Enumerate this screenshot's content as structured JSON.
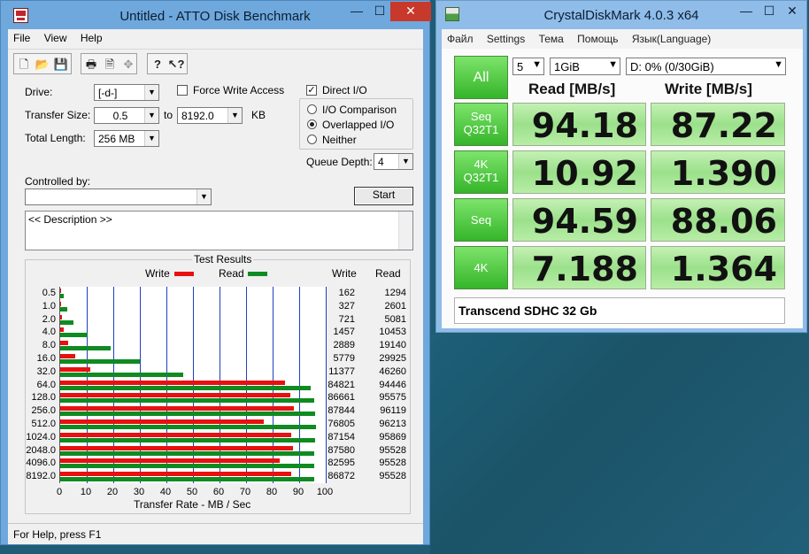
{
  "atto": {
    "title": "Untitled - ATTO Disk Benchmark",
    "window_buttons": {
      "minimize": "—",
      "maximize": "☐",
      "close": "✕"
    },
    "menu": [
      "File",
      "View",
      "Help"
    ],
    "toolbar_icons": [
      "new-icon",
      "open-icon",
      "save-icon",
      "print-icon",
      "print-preview-icon",
      "move-icon",
      "help-icon",
      "context-help-icon"
    ],
    "drive_label": "Drive:",
    "drive_value": "[-d-]",
    "force_write_access_label": "Force Write Access",
    "direct_io_label": "Direct I/O",
    "transfer_size_label": "Transfer Size:",
    "transfer_size_from": "0.5",
    "to_label": "to",
    "transfer_size_to": "8192.0",
    "kb_label": "KB",
    "total_length_label": "Total Length:",
    "total_length_value": "256 MB",
    "io_comparison_label": "I/O Comparison",
    "overlapped_io_label": "Overlapped I/O",
    "neither_label": "Neither",
    "queue_depth_label": "Queue Depth:",
    "queue_depth_value": "4",
    "controlled_by_label": "Controlled by:",
    "controlled_by_value": "",
    "start_label": "Start",
    "description": "<< Description >>",
    "status": "For Help, press F1",
    "results": {
      "title": "Test Results",
      "legend_write": "Write",
      "legend_read": "Read",
      "col_write": "Write",
      "col_read": "Read",
      "xlabel": "Transfer Rate - MB / Sec",
      "xticks": [
        "0",
        "10",
        "20",
        "30",
        "40",
        "50",
        "60",
        "70",
        "80",
        "90",
        "100"
      ],
      "write_color": "#e81010",
      "read_color": "#0f8b21"
    }
  },
  "chart_data": {
    "type": "bar",
    "orientation": "horizontal",
    "title": "Test Results",
    "xlabel": "Transfer Rate - MB / Sec",
    "xlim": [
      0,
      100
    ],
    "categories": [
      "0.5",
      "1.0",
      "2.0",
      "4.0",
      "8.0",
      "16.0",
      "32.0",
      "64.0",
      "128.0",
      "256.0",
      "512.0",
      "1024.0",
      "2048.0",
      "4096.0",
      "8192.0"
    ],
    "series": [
      {
        "name": "Write",
        "values": [
          162,
          327,
          721,
          1457,
          2889,
          5779,
          11377,
          84821,
          86661,
          87844,
          76805,
          87154,
          87580,
          82595,
          86872
        ]
      },
      {
        "name": "Read",
        "values": [
          1294,
          2601,
          5081,
          10453,
          19140,
          29925,
          46260,
          94446,
          95575,
          96119,
          96213,
          95869,
          95528,
          95528,
          95528
        ]
      }
    ],
    "value_units": "KB/s",
    "grid": true,
    "legend": "top"
  },
  "cdm": {
    "title": "CrystalDiskMark 4.0.3 x64",
    "window_buttons": {
      "minimize": "—",
      "maximize": "☐",
      "close": "✕"
    },
    "menu": [
      "Файл",
      "Settings",
      "Тема",
      "Помощь",
      "Язык(Language)"
    ],
    "all_label": "All",
    "count_value": "5",
    "size_value": "1GiB",
    "drive_value": "D: 0% (0/30GiB)",
    "read_header": "Read [MB/s]",
    "write_header": "Write [MB/s]",
    "rows": [
      {
        "line1": "Seq",
        "line2": "Q32T1",
        "read": "94.18",
        "write": "87.22"
      },
      {
        "line1": "4K",
        "line2": "Q32T1",
        "read": "10.92",
        "write": "1.390"
      },
      {
        "line1": "Seq",
        "line2": "",
        "read": "94.59",
        "write": "88.06"
      },
      {
        "line1": "4K",
        "line2": "",
        "read": "7.188",
        "write": "1.364"
      }
    ],
    "comment": "Transcend SDHC 32 Gb"
  }
}
